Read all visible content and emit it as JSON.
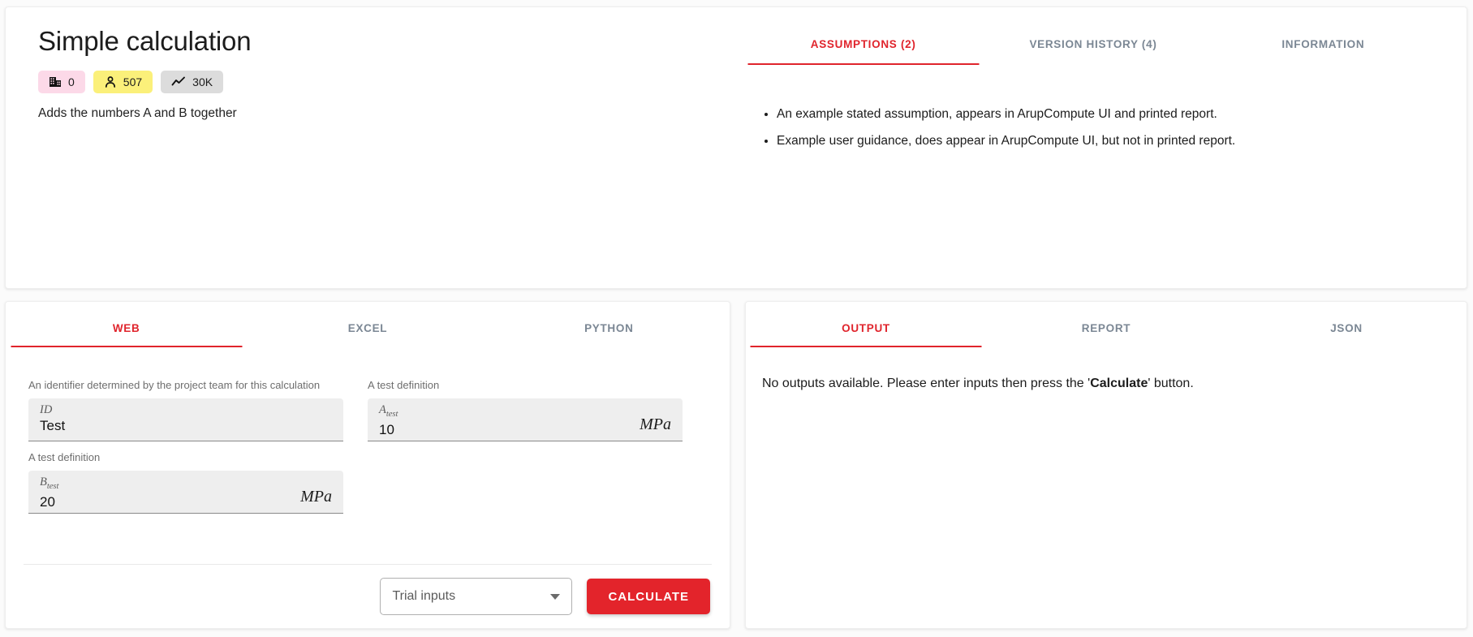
{
  "header": {
    "title": "Simple calculation",
    "description": "Adds the numbers A and B together",
    "badges": [
      {
        "icon": "building-icon",
        "value": "0",
        "color": "#fcd9e8"
      },
      {
        "icon": "person-icon",
        "value": "507",
        "color": "#fbf07a"
      },
      {
        "icon": "trend-line-icon",
        "value": "30K",
        "color": "#dcdcdc"
      }
    ]
  },
  "info_tabs": {
    "items": [
      {
        "label": "ASSUMPTIONS (2)",
        "active": true
      },
      {
        "label": "VERSION HISTORY (4)",
        "active": false
      },
      {
        "label": "INFORMATION",
        "active": false
      }
    ],
    "assumptions": [
      "An example stated assumption, appears in ArupCompute UI and printed report.",
      "Example user guidance, does appear in ArupCompute UI, but not in printed report."
    ]
  },
  "input_panel": {
    "tabs": [
      {
        "label": "WEB",
        "active": true
      },
      {
        "label": "EXCEL",
        "active": false
      },
      {
        "label": "PYTHON",
        "active": false
      }
    ],
    "fields": [
      {
        "hint": "An identifier determined by the project team for this calculation",
        "label": "ID",
        "sub": "",
        "value": "Test",
        "unit": ""
      },
      {
        "hint": "A test definition",
        "label": "A",
        "sub": "test",
        "value": "10",
        "unit": "MPa"
      },
      {
        "hint": "A test definition",
        "label": "B",
        "sub": "test",
        "value": "20",
        "unit": "MPa"
      }
    ],
    "trial_select": {
      "value": "Trial inputs",
      "options": [
        "Trial inputs"
      ]
    },
    "calculate_label": "CALCULATE"
  },
  "output_panel": {
    "tabs": [
      {
        "label": "OUTPUT",
        "active": true
      },
      {
        "label": "REPORT",
        "active": false
      },
      {
        "label": "JSON",
        "active": false
      }
    ],
    "message_prefix": "No outputs available. Please enter inputs then press the '",
    "message_bold": "Calculate",
    "message_suffix": "' button."
  },
  "colors": {
    "accent": "#e0242c",
    "button": "#e3242b",
    "tab_inactive": "#7b8794",
    "field_bg": "#eeeeee"
  }
}
